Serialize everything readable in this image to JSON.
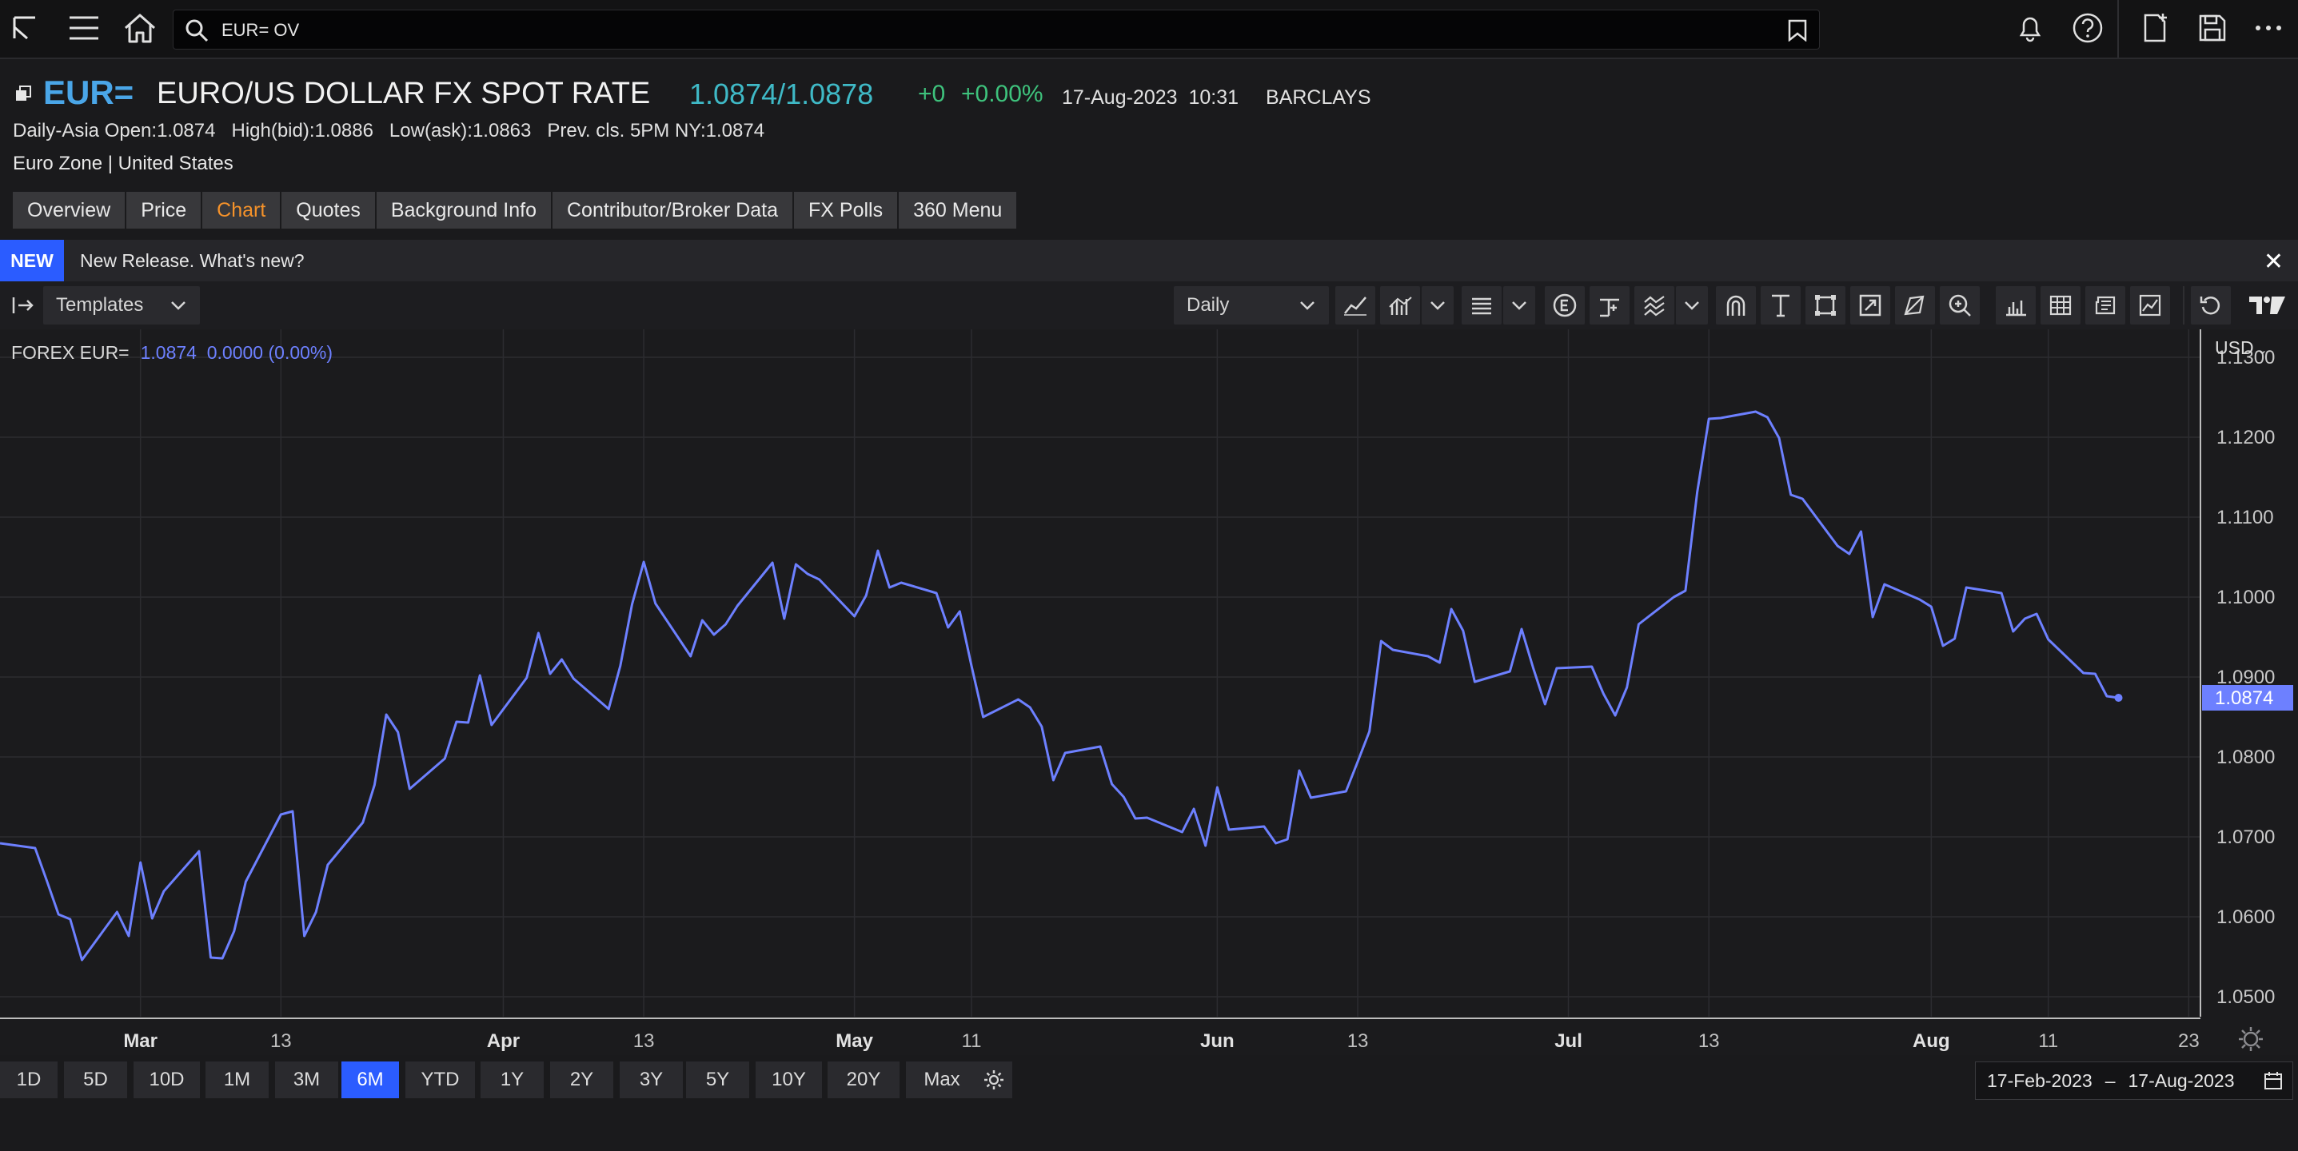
{
  "topbar": {
    "search_value": "EUR= OV"
  },
  "header": {
    "ric": "EUR=",
    "name": "EURO/US DOLLAR FX SPOT RATE",
    "bid_ask": "1.0874/1.0878",
    "change": "+0",
    "change_pct": "+0.00%",
    "datetime": "17-Aug-2023  10:31",
    "contributor": "BARCLAYS",
    "ohlc_line": "Daily-Asia Open:1.0874   High(bid):1.0886   Low(ask):1.0863   Prev. cls. 5PM NY:1.0874",
    "region": "Euro Zone | United States"
  },
  "tabs": [
    {
      "label": "Overview"
    },
    {
      "label": "Price"
    },
    {
      "label": "Chart",
      "active": true
    },
    {
      "label": "Quotes"
    },
    {
      "label": "Background Info"
    },
    {
      "label": "Contributor/Broker Data"
    },
    {
      "label": "FX Polls"
    },
    {
      "label": "360 Menu"
    }
  ],
  "banner": {
    "badge": "NEW",
    "text": "New Release. What's new?",
    "close": "✕"
  },
  "toolbar": {
    "templates_label": "Templates",
    "interval_label": "Daily"
  },
  "colors": {
    "line": "#6d80ff",
    "accent": "#2b5cff",
    "active_tab": "#f5922a",
    "up": "#3ec27c",
    "price": "#3fb9c6",
    "ric": "#4aa6e8"
  },
  "chart_data": {
    "type": "line",
    "series_label": "FOREX EUR=",
    "series_value": "1.0874  0.0000 (0.00%)",
    "currency": "USD",
    "last_value_label": "1.0874",
    "ylim": [
      1.0475,
      1.1335
    ],
    "yticks": [
      1.05,
      1.06,
      1.07,
      1.08,
      1.09,
      1.1,
      1.11,
      1.12,
      1.13
    ],
    "ytick_labels": [
      "1.0500",
      "1.0600",
      "1.0700",
      "1.0800",
      "1.0900",
      "1.1000",
      "1.1100",
      "1.1200",
      "1.1300"
    ],
    "x_range": [
      "2023-02-17",
      "2023-08-24"
    ],
    "xticks": [
      {
        "date": "2023-03-01",
        "label": "Mar",
        "major": true
      },
      {
        "date": "2023-03-13",
        "label": "13",
        "major": false
      },
      {
        "date": "2023-04-01",
        "label": "Apr",
        "major": true
      },
      {
        "date": "2023-04-13",
        "label": "13",
        "major": false
      },
      {
        "date": "2023-05-01",
        "label": "May",
        "major": true
      },
      {
        "date": "2023-05-11",
        "label": "11",
        "major": false
      },
      {
        "date": "2023-06-01",
        "label": "Jun",
        "major": true
      },
      {
        "date": "2023-06-13",
        "label": "13",
        "major": false
      },
      {
        "date": "2023-07-01",
        "label": "Jul",
        "major": true
      },
      {
        "date": "2023-07-13",
        "label": "13",
        "major": false
      },
      {
        "date": "2023-08-01",
        "label": "Aug",
        "major": true
      },
      {
        "date": "2023-08-11",
        "label": "11",
        "major": false
      },
      {
        "date": "2023-08-23",
        "label": "23",
        "major": false
      }
    ],
    "series": [
      {
        "name": "FOREX EUR=",
        "x": [
          "2023-02-17",
          "2023-02-20",
          "2023-02-21",
          "2023-02-22",
          "2023-02-23",
          "2023-02-24",
          "2023-02-27",
          "2023-02-28",
          "2023-03-01",
          "2023-03-02",
          "2023-03-03",
          "2023-03-06",
          "2023-03-07",
          "2023-03-08",
          "2023-03-09",
          "2023-03-10",
          "2023-03-13",
          "2023-03-14",
          "2023-03-15",
          "2023-03-16",
          "2023-03-17",
          "2023-03-20",
          "2023-03-21",
          "2023-03-22",
          "2023-03-23",
          "2023-03-24",
          "2023-03-27",
          "2023-03-28",
          "2023-03-29",
          "2023-03-30",
          "2023-03-31",
          "2023-04-03",
          "2023-04-04",
          "2023-04-05",
          "2023-04-06",
          "2023-04-07",
          "2023-04-10",
          "2023-04-11",
          "2023-04-12",
          "2023-04-13",
          "2023-04-14",
          "2023-04-17",
          "2023-04-18",
          "2023-04-19",
          "2023-04-20",
          "2023-04-21",
          "2023-04-24",
          "2023-04-25",
          "2023-04-26",
          "2023-04-27",
          "2023-04-28",
          "2023-05-01",
          "2023-05-02",
          "2023-05-03",
          "2023-05-04",
          "2023-05-05",
          "2023-05-08",
          "2023-05-09",
          "2023-05-10",
          "2023-05-11",
          "2023-05-12",
          "2023-05-15",
          "2023-05-16",
          "2023-05-17",
          "2023-05-18",
          "2023-05-19",
          "2023-05-22",
          "2023-05-23",
          "2023-05-24",
          "2023-05-25",
          "2023-05-26",
          "2023-05-29",
          "2023-05-30",
          "2023-05-31",
          "2023-06-01",
          "2023-06-02",
          "2023-06-05",
          "2023-06-06",
          "2023-06-07",
          "2023-06-08",
          "2023-06-09",
          "2023-06-12",
          "2023-06-13",
          "2023-06-14",
          "2023-06-15",
          "2023-06-16",
          "2023-06-19",
          "2023-06-20",
          "2023-06-21",
          "2023-06-22",
          "2023-06-23",
          "2023-06-26",
          "2023-06-27",
          "2023-06-28",
          "2023-06-29",
          "2023-06-30",
          "2023-07-03",
          "2023-07-04",
          "2023-07-05",
          "2023-07-06",
          "2023-07-07",
          "2023-07-10",
          "2023-07-11",
          "2023-07-12",
          "2023-07-13",
          "2023-07-14",
          "2023-07-17",
          "2023-07-18",
          "2023-07-19",
          "2023-07-20",
          "2023-07-21",
          "2023-07-24",
          "2023-07-25",
          "2023-07-26",
          "2023-07-27",
          "2023-07-28",
          "2023-07-31",
          "2023-08-01",
          "2023-08-02",
          "2023-08-03",
          "2023-08-04",
          "2023-08-07",
          "2023-08-08",
          "2023-08-09",
          "2023-08-10",
          "2023-08-11",
          "2023-08-14",
          "2023-08-15",
          "2023-08-16",
          "2023-08-17"
        ],
        "values": [
          1.0692,
          1.0686,
          1.0645,
          1.0603,
          1.0597,
          1.0546,
          1.0606,
          1.0576,
          1.0668,
          1.0598,
          1.0632,
          1.0682,
          1.0549,
          1.0548,
          1.0582,
          1.0644,
          1.0728,
          1.0732,
          1.0576,
          1.0606,
          1.0665,
          1.0718,
          1.0765,
          1.0853,
          1.0831,
          1.076,
          1.0798,
          1.0844,
          1.0843,
          1.0902,
          1.084,
          1.0899,
          1.0955,
          1.0904,
          1.0922,
          1.0898,
          1.086,
          1.0914,
          1.0991,
          1.1044,
          1.0992,
          1.0926,
          1.0971,
          1.0953,
          1.0966,
          1.0989,
          1.1043,
          1.0973,
          1.1041,
          1.1029,
          1.1022,
          1.0976,
          1.1002,
          1.1058,
          1.1012,
          1.1018,
          1.1005,
          1.0962,
          1.0982,
          1.0914,
          1.085,
          1.0872,
          1.0862,
          1.0838,
          1.0771,
          1.0805,
          1.0813,
          1.0766,
          1.075,
          1.0723,
          1.0724,
          1.0706,
          1.0735,
          1.0689,
          1.0762,
          1.0709,
          1.0713,
          1.0692,
          1.0697,
          1.0783,
          1.0749,
          1.0757,
          1.0794,
          1.0832,
          1.0945,
          1.0934,
          1.0926,
          1.0918,
          1.0985,
          1.0958,
          1.0894,
          1.0907,
          1.096,
          1.0911,
          1.0866,
          1.0911,
          1.0913,
          1.0879,
          1.0852,
          1.0887,
          1.0966,
          1.1,
          1.1008,
          1.1131,
          1.1223,
          1.1224,
          1.1232,
          1.1225,
          1.1199,
          1.1128,
          1.1123,
          1.1064,
          1.1054,
          1.1082,
          1.0975,
          1.1016,
          1.0997,
          1.0988,
          1.0939,
          1.0948,
          1.1012,
          1.1005,
          1.0957,
          1.0973,
          1.0979,
          1.0947,
          1.0905,
          1.0904,
          1.0876,
          1.0874
        ]
      }
    ]
  },
  "range_buttons": [
    {
      "label": "1D"
    },
    {
      "label": "5D"
    },
    {
      "label": "10D"
    },
    {
      "label": "1M"
    },
    {
      "label": "3M"
    },
    {
      "label": "6M",
      "active": true
    },
    {
      "label": "YTD"
    },
    {
      "label": "1Y"
    },
    {
      "label": "2Y"
    },
    {
      "label": "3Y"
    },
    {
      "label": "5Y"
    },
    {
      "label": "10Y"
    },
    {
      "label": "20Y"
    },
    {
      "label": "Max"
    }
  ],
  "date_range": {
    "from": "17-Feb-2023",
    "sep": "–",
    "to": "17-Aug-2023"
  }
}
